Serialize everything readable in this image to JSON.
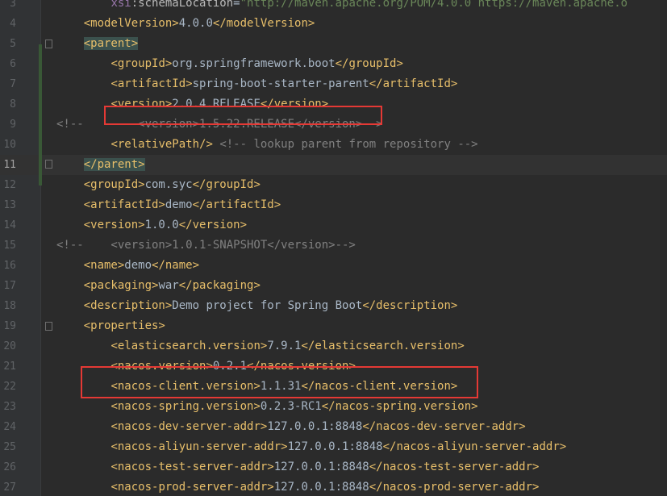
{
  "lines": [
    {
      "n": "3",
      "code": "        xsi:schemaLocation=\"http://maven.apache.org/POM/4.0.0 https://maven.apache.o"
    },
    {
      "n": "4",
      "code": "    <modelVersion>4.0.0</modelVersion>"
    },
    {
      "n": "5",
      "code": "    <parent>"
    },
    {
      "n": "6",
      "code": "        <groupId>org.springframework.boot</groupId>"
    },
    {
      "n": "7",
      "code": "        <artifactId>spring-boot-starter-parent</artifactId>"
    },
    {
      "n": "8",
      "code": "        <version>2.0.4.RELEASE</version>"
    },
    {
      "n": "9",
      "code": "<!--        <version>1.5.22.RELEASE</version>-->"
    },
    {
      "n": "10",
      "code": "        <relativePath/> <!-- lookup parent from repository -->"
    },
    {
      "n": "11",
      "code": "    </parent>"
    },
    {
      "n": "12",
      "code": "    <groupId>com.syc</groupId>"
    },
    {
      "n": "13",
      "code": "    <artifactId>demo</artifactId>"
    },
    {
      "n": "14",
      "code": "    <version>1.0.0</version>"
    },
    {
      "n": "15",
      "code": "<!--    <version>1.0.1-SNAPSHOT</version>-->"
    },
    {
      "n": "16",
      "code": "    <name>demo</name>"
    },
    {
      "n": "17",
      "code": "    <packaging>war</packaging>"
    },
    {
      "n": "18",
      "code": "    <description>Demo project for Spring Boot</description>"
    },
    {
      "n": "19",
      "code": "    <properties>"
    },
    {
      "n": "20",
      "code": "        <elasticsearch.version>7.9.1</elasticsearch.version>"
    },
    {
      "n": "21",
      "code": "        <nacos.version>0.2.1</nacos.version>"
    },
    {
      "n": "22",
      "code": "        <nacos-client.version>1.1.31</nacos-client.version>"
    },
    {
      "n": "23",
      "code": "        <nacos-spring.version>0.2.3-RC1</nacos-spring.version>"
    },
    {
      "n": "24",
      "code": "        <nacos-dev-server-addr>127.0.0.1:8848</nacos-dev-server-addr>"
    },
    {
      "n": "25",
      "code": "        <nacos-aliyun-server-addr>127.0.0.1:8848</nacos-aliyun-server-addr>"
    },
    {
      "n": "26",
      "code": "        <nacos-test-server-addr>127.0.0.1:8848</nacos-test-server-addr>"
    },
    {
      "n": "27",
      "code": "        <nacos-prod-server-addr>127.0.0.1:8848</nacos-prod-server-addr>"
    }
  ],
  "current_line": "11",
  "highlights": [
    "version 2.0.4.RELEASE",
    "nacos.version 0.2.1"
  ],
  "colors": {
    "background": "#2b2b2b",
    "tag": "#e8bf6a",
    "text": "#a9b7c6",
    "comment": "#808080",
    "string": "#6a8759",
    "annotation_box": "#e53935"
  }
}
